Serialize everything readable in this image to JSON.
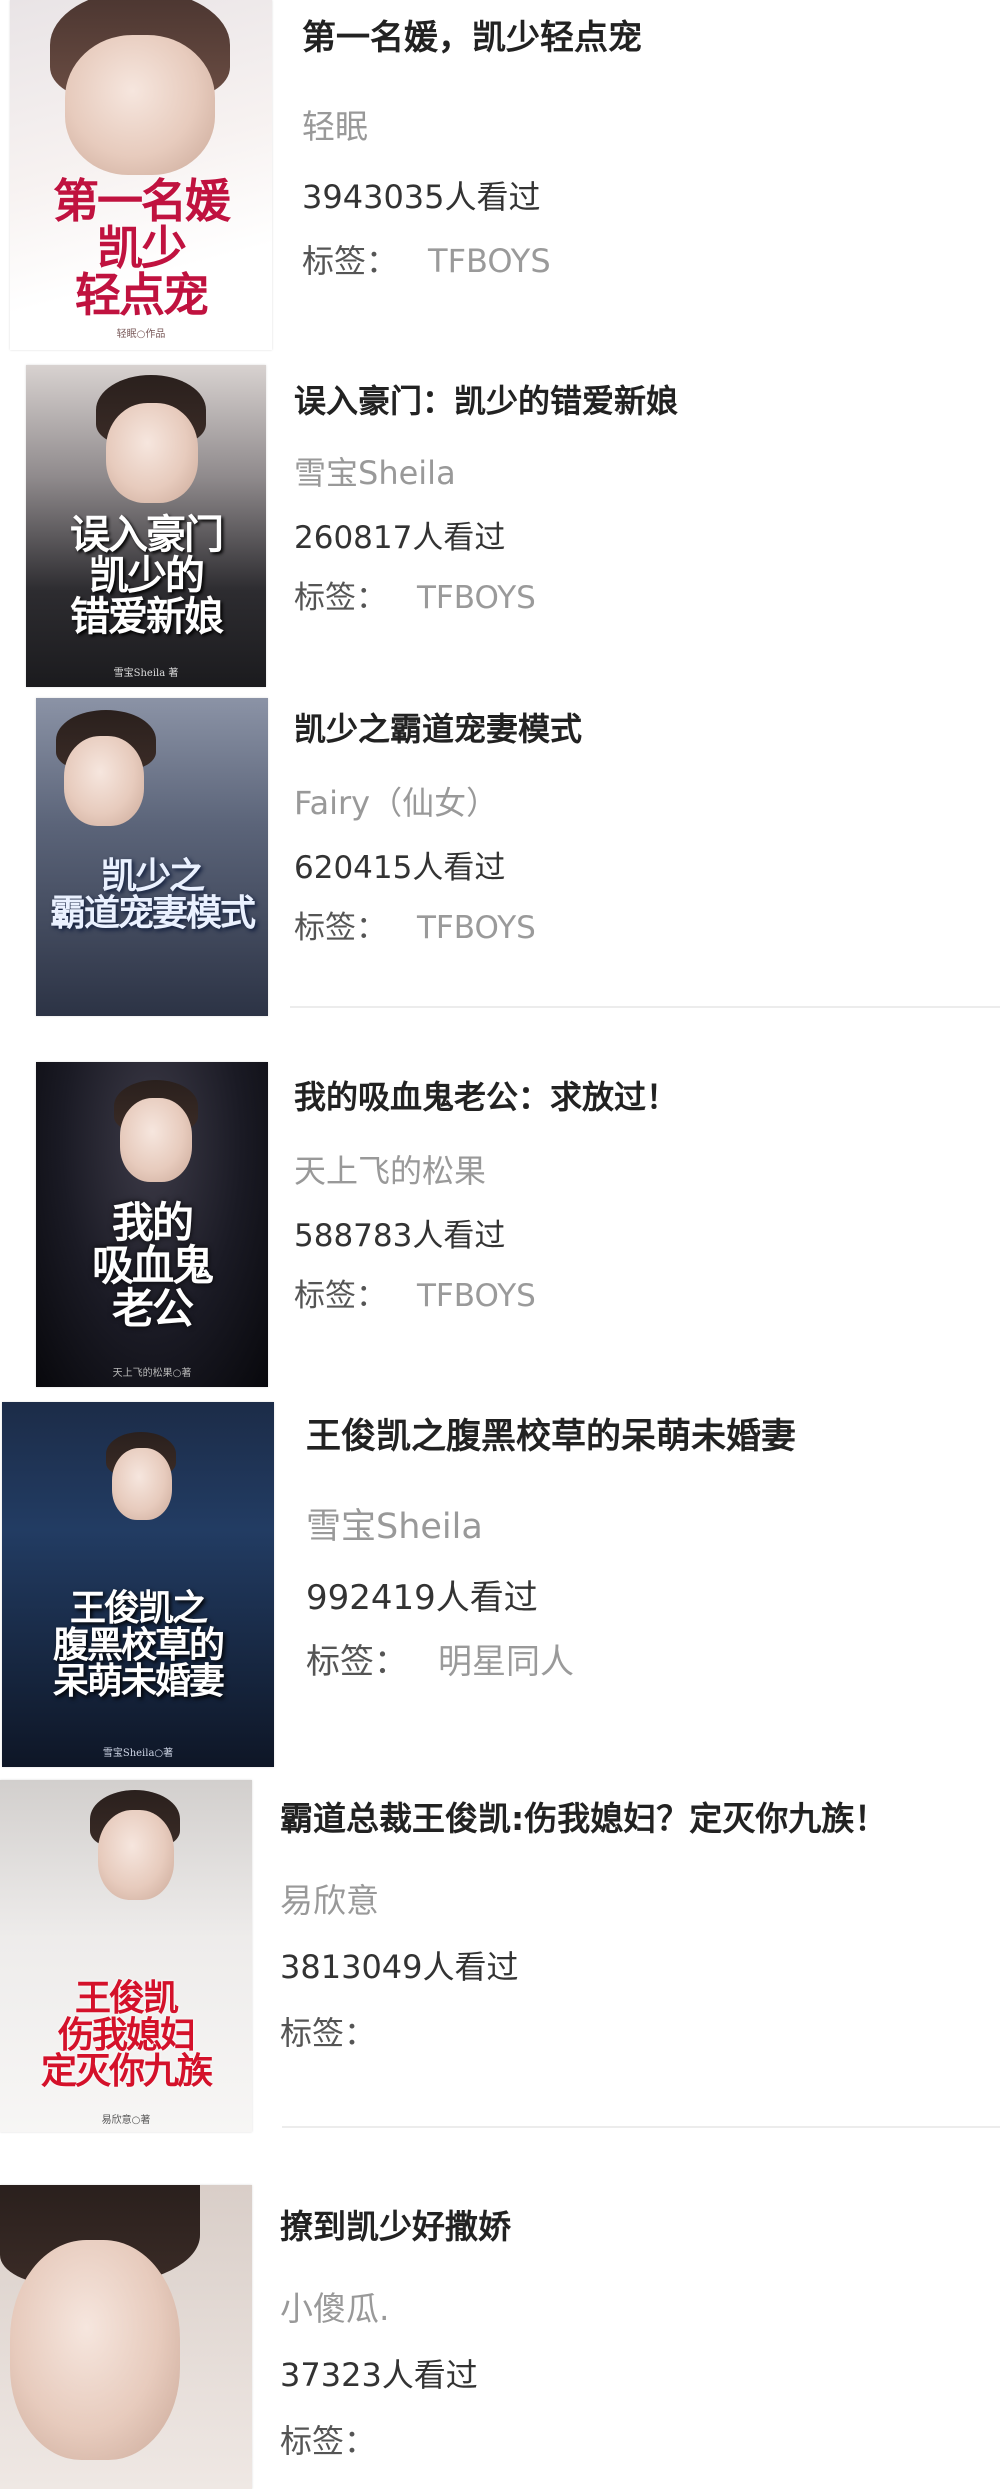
{
  "books": [
    {
      "title": "第一名媛，凯少轻点宠",
      "author": "轻眠",
      "views": "3943035人看过",
      "tags_label": "标签：",
      "tag": "TFBOYS",
      "cover_text": "第一名媛\n凯少\n轻点宠",
      "cover_byline": "轻眠○作品"
    },
    {
      "title": "误入豪门：凯少的错爱新娘",
      "author": "雪宝Sheila",
      "views": "260817人看过",
      "tags_label": "标签：",
      "tag": "TFBOYS",
      "cover_text": "误入豪门\n凯少的\n错爱新娘",
      "cover_byline": "雪宝Sheila 著"
    },
    {
      "title": "凯少之霸道宠妻模式",
      "author": "Fairy（仙女）",
      "views": "620415人看过",
      "tags_label": "标签：",
      "tag": "TFBOYS",
      "cover_text": "凯少之\n霸道宠妻模式",
      "cover_byline": ""
    },
    {
      "title": "我的吸血鬼老公：求放过！",
      "author": "天上飞的松果",
      "views": "588783人看过",
      "tags_label": "标签：",
      "tag": "TFBOYS",
      "cover_text": "我的\n吸血鬼\n老公",
      "cover_byline": "天上飞的松果○著"
    },
    {
      "title": "王俊凯之腹黑校草的呆萌未婚妻",
      "author": "雪宝Sheila",
      "views": "992419人看过",
      "tags_label": "标签：",
      "tag": "明星同人",
      "cover_text": "王俊凯之\n腹黑校草的\n呆萌未婚妻",
      "cover_byline": "雪宝Sheila○著"
    },
    {
      "title": "霸道总裁王俊凯:伤我媳妇？定灭你九族！",
      "author": "易欣意",
      "views": "3813049人看过",
      "tags_label": "标签：",
      "tag": "",
      "cover_text": "王俊凯\n伤我媳妇\n定灭你九族",
      "cover_byline": "易欣意○著"
    },
    {
      "title": "撩到凯少好撒娇",
      "author": "小傻瓜.",
      "views": "37323人看过",
      "tags_label": "标签：",
      "tag": "",
      "cover_text": "",
      "cover_byline": ""
    }
  ]
}
